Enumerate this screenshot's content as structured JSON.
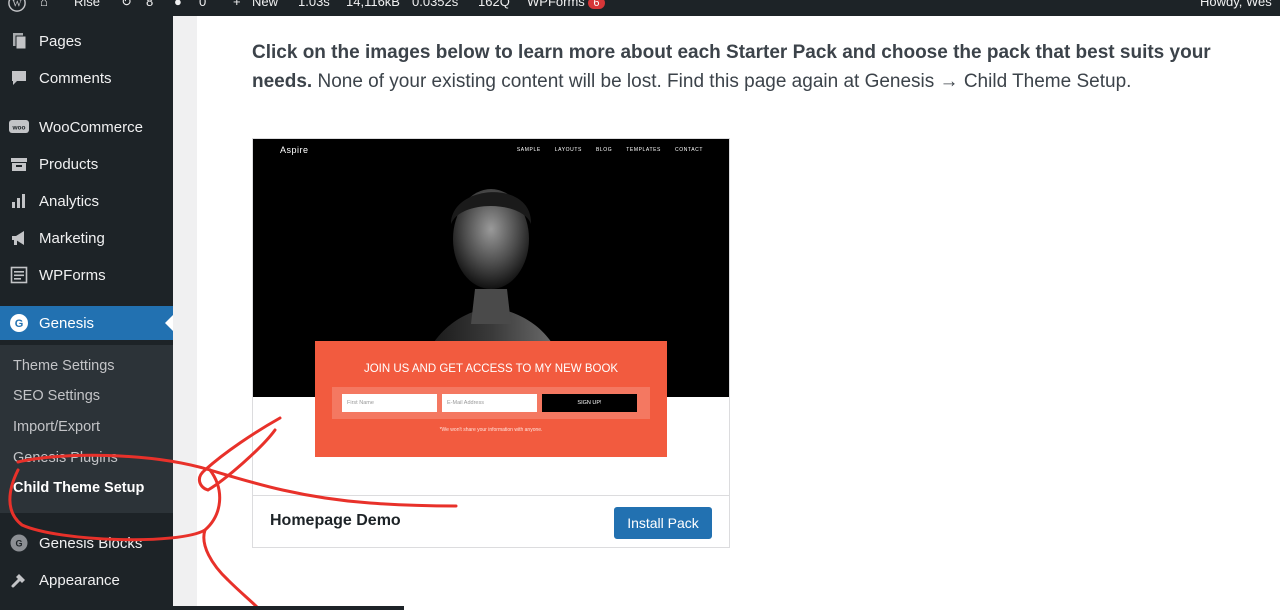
{
  "admin_bar": {
    "site_name": "Rise",
    "updates_count": "8",
    "comments_count": "0",
    "new_label": "New",
    "stats": [
      "1.03s",
      "14,116kB",
      "0.0352s",
      "162Q"
    ],
    "wpforms_label": "WPForms",
    "wpforms_badge": "6",
    "howdy": "Howdy, Wes"
  },
  "sidebar": {
    "items": [
      {
        "label": "Pages",
        "icon": "pages-icon"
      },
      {
        "label": "Comments",
        "icon": "comments-icon"
      },
      {
        "label": "WooCommerce",
        "icon": "woocommerce-icon"
      },
      {
        "label": "Products",
        "icon": "products-icon"
      },
      {
        "label": "Analytics",
        "icon": "analytics-icon"
      },
      {
        "label": "Marketing",
        "icon": "marketing-icon"
      },
      {
        "label": "WPForms",
        "icon": "wpforms-icon"
      },
      {
        "label": "Genesis",
        "icon": "genesis-icon",
        "active": true
      },
      {
        "label": "Genesis Blocks",
        "icon": "genesis-blocks-icon"
      },
      {
        "label": "Appearance",
        "icon": "appearance-icon"
      }
    ],
    "submenu": [
      {
        "label": "Theme Settings"
      },
      {
        "label": "SEO Settings"
      },
      {
        "label": "Import/Export"
      },
      {
        "label": "Genesis Plugins"
      },
      {
        "label": "Child Theme Setup",
        "current": true
      }
    ]
  },
  "main": {
    "intro_bold": "Click on the images below to learn more about each Starter Pack and choose the pack that best suits your needs.",
    "intro_rest": " None of your existing content will be lost. Find this page again at Genesis → Child Theme Setup."
  },
  "pack": {
    "preview": {
      "brand": "Aspire",
      "nav": [
        "SAMPLE",
        "LAYOUTS",
        "BLOG",
        "TEMPLATES",
        "CONTACT"
      ],
      "optin_title": "JOIN US AND GET ACCESS TO MY NEW BOOK",
      "first_name_placeholder": "First Name",
      "email_placeholder": "E-Mail Address",
      "signup_label": "SIGN UP!",
      "note": "*We won't share your information with anyone."
    },
    "title": "Homepage Demo",
    "install_label": "Install Pack"
  },
  "colors": {
    "admin_dark": "#1d2327",
    "active_blue": "#2271b1",
    "optin_orange": "#f25b3f",
    "annotation_red": "#e8312a"
  }
}
